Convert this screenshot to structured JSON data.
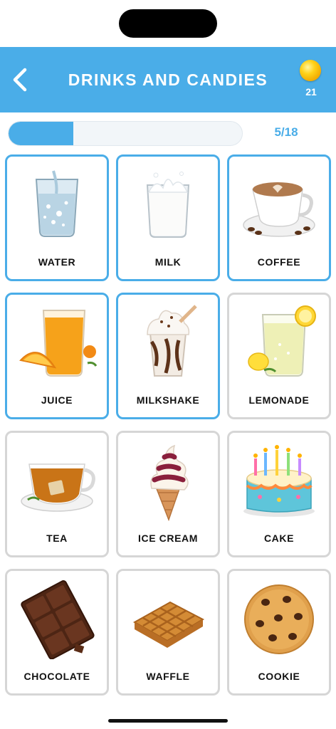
{
  "header": {
    "title": "DRINKS AND CANDIES",
    "back_icon": "chevron-left-icon",
    "coin_icon": "gold-coin-icon",
    "coins": "21",
    "background": "#4aade8"
  },
  "progress": {
    "current": 5,
    "total": 18,
    "fraction": 0.2778,
    "label": "5/18"
  },
  "items": [
    {
      "label": "WATER",
      "icon": "water-glass-icon",
      "active": true
    },
    {
      "label": "MILK",
      "icon": "milk-glass-icon",
      "active": true
    },
    {
      "label": "COFFEE",
      "icon": "coffee-cup-icon",
      "active": true
    },
    {
      "label": "JUICE",
      "icon": "orange-juice-icon",
      "active": true
    },
    {
      "label": "MILKSHAKE",
      "icon": "milkshake-icon",
      "active": true
    },
    {
      "label": "LEMONADE",
      "icon": "lemonade-icon",
      "active": false
    },
    {
      "label": "TEA",
      "icon": "tea-cup-icon",
      "active": false
    },
    {
      "label": "ICE CREAM",
      "icon": "ice-cream-icon",
      "active": false
    },
    {
      "label": "CAKE",
      "icon": "birthday-cake-icon",
      "active": false
    },
    {
      "label": "CHOCOLATE",
      "icon": "chocolate-bar-icon",
      "active": false
    },
    {
      "label": "WAFFLE",
      "icon": "waffle-icon",
      "active": false
    },
    {
      "label": "COOKIE",
      "icon": "cookie-icon",
      "active": false
    }
  ],
  "colors": {
    "accent": "#4aade8",
    "inactive_border": "#d6d6d6"
  }
}
